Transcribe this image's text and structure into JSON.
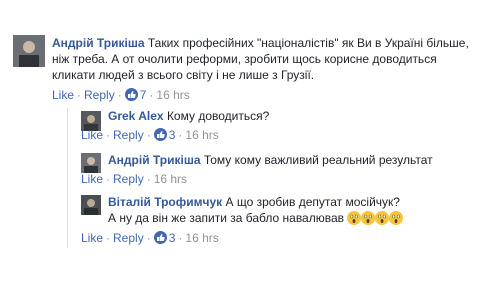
{
  "comments": [
    {
      "author": "Андрій Трикіша",
      "lines": [
        "Таких професійних \"націоналістів\" як Ви в Україні більше,",
        "ніж треба. А от очолити реформи, зробити щось корисне доводиться",
        "кликати людей з всього світу і не лише з Грузії."
      ],
      "like_label": "Like",
      "reply_label": "Reply",
      "reaction_count": "7",
      "time": "16 hrs"
    },
    {
      "author": "Grek Alex",
      "lines": [
        "Кому доводиться?"
      ],
      "like_label": "Like",
      "reply_label": "Reply",
      "reaction_count": "3",
      "time": "16 hrs"
    },
    {
      "author": "Андрій Трикіша",
      "lines": [
        "Тому кому важливий реальний результат"
      ],
      "like_label": "Like",
      "reply_label": "Reply",
      "reaction_count": "",
      "time": "16 hrs"
    },
    {
      "author": "Віталій Трофимчук",
      "lines": [
        "А що зробив депутат мосійчук?",
        "А ну да він же запити за бабло навалював"
      ],
      "like_label": "Like",
      "reply_label": "Reply",
      "reaction_count": "3",
      "time": "16 hrs"
    }
  ],
  "icons": {
    "reaction": "like-thumb-icon",
    "emoji": "scream-face-emoji"
  },
  "colors": {
    "link": "#365899",
    "action": "#4267b2",
    "meta": "#90949c",
    "badge": "#4267b2"
  }
}
